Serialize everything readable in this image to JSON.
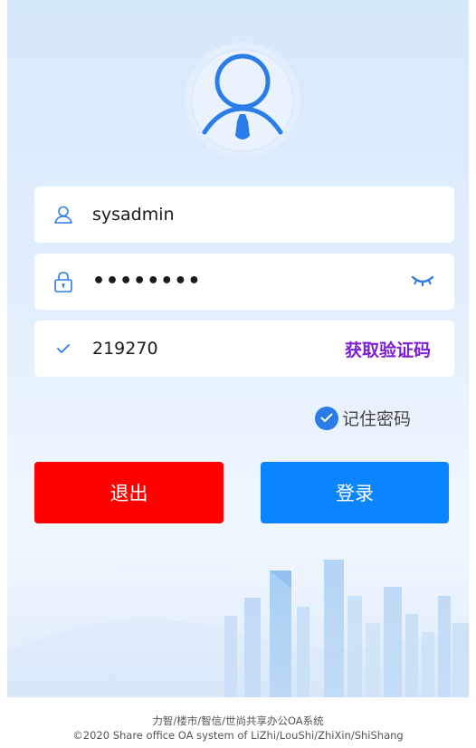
{
  "login": {
    "username": "sysadmin",
    "password_masked": "••••••••",
    "captcha_value": "219270",
    "get_code_label": "获取验证码",
    "remember_label": "记住密码",
    "remember_checked": true
  },
  "buttons": {
    "exit_label": "退出",
    "login_label": "登录"
  },
  "footer": {
    "line1": "力智/楼市/智信/世尚共享办公OA系统",
    "line2": "©2020 Share office OA system of LiZhi/LouShi/ZhiXin/ShiShang"
  },
  "colors": {
    "exit": "#fd0000",
    "login": "#0a84ff",
    "accent_icon": "#2a7de8",
    "get_code": "#7d1fd6"
  },
  "icons": {
    "avatar": "user-avatar-icon",
    "username": "user-icon",
    "password": "lock-icon",
    "toggle_password": "eye-closed-icon",
    "captcha": "check-icon",
    "remember": "check-circle-icon"
  }
}
